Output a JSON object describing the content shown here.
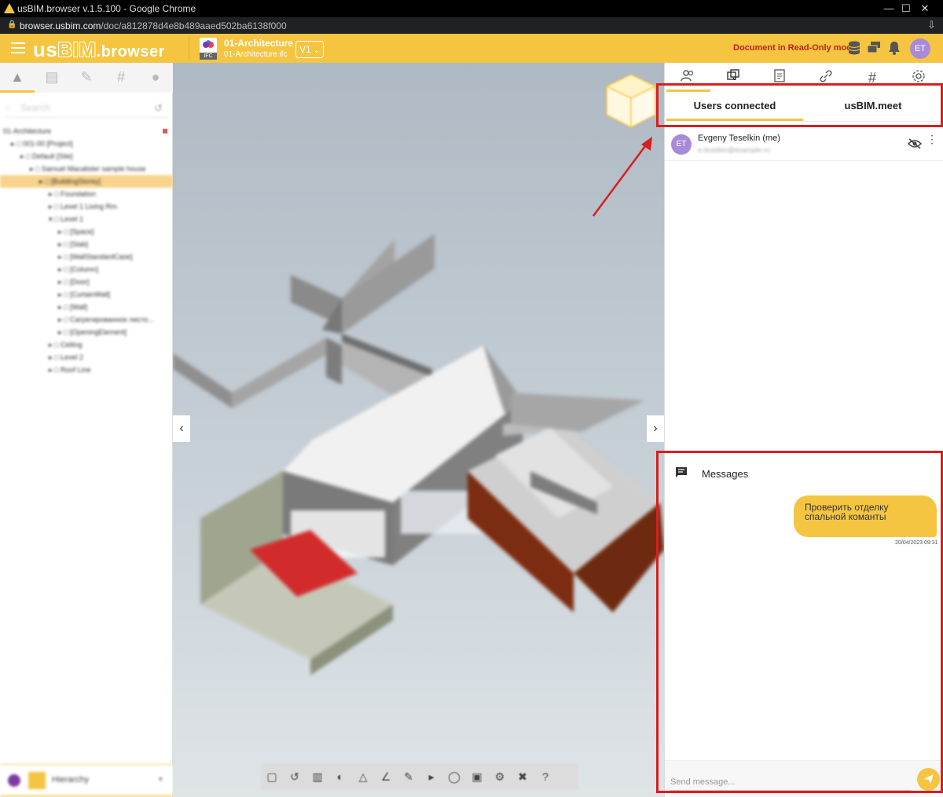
{
  "window": {
    "title": "usBIM.browser v.1.5.100 - Google Chrome",
    "url_domain": "browser.usbim.com",
    "url_path": "/doc/a812878d4e8b489aaed502ba6138f000"
  },
  "header": {
    "logo_us": "us",
    "logo_bim": "BIM",
    "logo_browser": ".browser",
    "file_badge": "IFC",
    "document_name": "01-Architecture",
    "document_file": "01-Architecture.ifc",
    "version": "V1",
    "readonly_text": "Document in Read-Only mode",
    "avatar_initials": "ET"
  },
  "left_panel": {
    "search_placeholder": "Search",
    "tree": [
      {
        "label": "01-Architecture",
        "depth": 0
      },
      {
        "label": "001-00 [Project]",
        "depth": 1
      },
      {
        "label": "Default [Site]",
        "depth": 2
      },
      {
        "label": "Samuel Macalister sample house",
        "depth": 3
      },
      {
        "label": "[BuildingStorey]",
        "depth": 4,
        "selected": true
      },
      {
        "label": "Foundation",
        "depth": 5
      },
      {
        "label": "Level 1 Living Rm.",
        "depth": 5
      },
      {
        "label": "Level 1",
        "depth": 5
      },
      {
        "label": "[Space]",
        "depth": 6
      },
      {
        "label": "[Slab]",
        "depth": 6
      },
      {
        "label": "[WallStandardCase]",
        "depth": 6
      },
      {
        "label": "[Column]",
        "depth": 6
      },
      {
        "label": "[Door]",
        "depth": 6
      },
      {
        "label": "[CurtainWall]",
        "depth": 6
      },
      {
        "label": "[Wall]",
        "depth": 6
      },
      {
        "label": "Сагрегированное листо...",
        "depth": 6
      },
      {
        "label": "[OpeningElement]",
        "depth": 6
      },
      {
        "label": "Ceiling",
        "depth": 5
      },
      {
        "label": "Level 2",
        "depth": 5
      },
      {
        "label": "Roof Line",
        "depth": 5
      }
    ],
    "bottom_label": "Hierarchy"
  },
  "right_panel": {
    "tabs": [
      "Users connected",
      "usBIM.meet"
    ],
    "user": {
      "initials": "ET",
      "name": "Evgeny Teselkin (me)",
      "email": "e.teselkin@example.ru"
    },
    "messages_title": "Messages",
    "message": {
      "text": "Проверить отделку спальной команты",
      "time": "20/04/2023 09:31"
    },
    "compose_placeholder": "Send message..."
  },
  "colors": {
    "accent": "#f5c542",
    "readonly": "#c0221b",
    "annotation": "#d61f1f",
    "avatar": "#a78bd8"
  }
}
